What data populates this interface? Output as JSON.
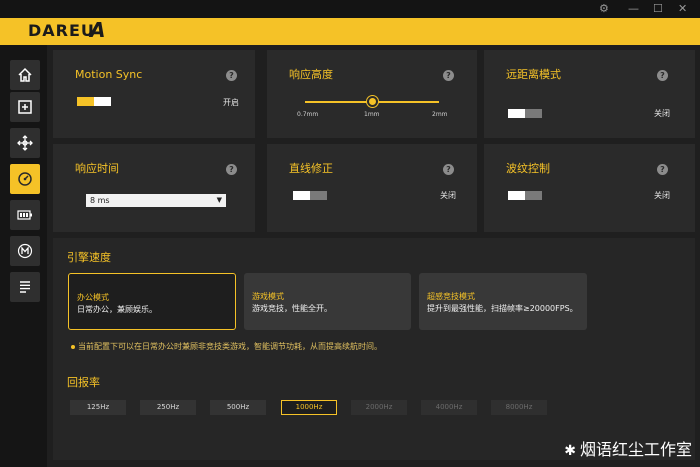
{
  "brand": {
    "logo": "DAREU",
    "mark": "A"
  },
  "window": {
    "settings": "⚙",
    "minimize": "—",
    "maximize": "☐",
    "close": "✕"
  },
  "sidebar": {
    "items": [
      {
        "name": "home-icon"
      },
      {
        "name": "plus-box-icon"
      },
      {
        "name": "move-arrows-icon"
      },
      {
        "name": "performance-icon",
        "active": true
      },
      {
        "name": "battery-icon"
      },
      {
        "name": "macro-m-icon"
      },
      {
        "name": "list-icon"
      }
    ]
  },
  "cards": {
    "motion_sync": {
      "title": "Motion Sync",
      "state": "开启",
      "toggle": "on"
    },
    "lod": {
      "title": "响应高度",
      "ticks": [
        "0.7mm",
        "1mm",
        "2mm"
      ],
      "value": "1mm"
    },
    "long_distance": {
      "title": "远距离模式",
      "state": "关闭",
      "toggle": "off"
    },
    "response_time": {
      "title": "响应时间",
      "select_value": "8 ms"
    },
    "angle_snap": {
      "title": "直线修正",
      "state": "关闭",
      "toggle": "off"
    },
    "ripple": {
      "title": "波纹控制",
      "state": "关闭",
      "toggle": "off"
    }
  },
  "engine": {
    "title": "引擎速度",
    "modes": [
      {
        "name": "办公模式",
        "desc": "日常办公，兼顾娱乐。",
        "selected": true
      },
      {
        "name": "游戏模式",
        "desc": "游戏竞技，性能全开。",
        "selected": false
      },
      {
        "name": "超感竞技模式",
        "desc": "提升到最强性能，扫描帧率≥20000FPS。",
        "selected": false
      }
    ],
    "note": "当前配置下可以在日常办公时兼顾非竞技类游戏，智能调节功耗，从而提高续航时间。"
  },
  "polling": {
    "title": "回报率",
    "rates": [
      {
        "label": "125Hz",
        "state": "normal"
      },
      {
        "label": "250Hz",
        "state": "normal"
      },
      {
        "label": "500Hz",
        "state": "normal"
      },
      {
        "label": "1000Hz",
        "state": "selected"
      },
      {
        "label": "2000Hz",
        "state": "disabled"
      },
      {
        "label": "4000Hz",
        "state": "disabled"
      },
      {
        "label": "8000Hz",
        "state": "disabled"
      }
    ]
  },
  "help_glyph": "?",
  "watermark": {
    "logo": "✱",
    "text": "烟语红尘工作室"
  }
}
